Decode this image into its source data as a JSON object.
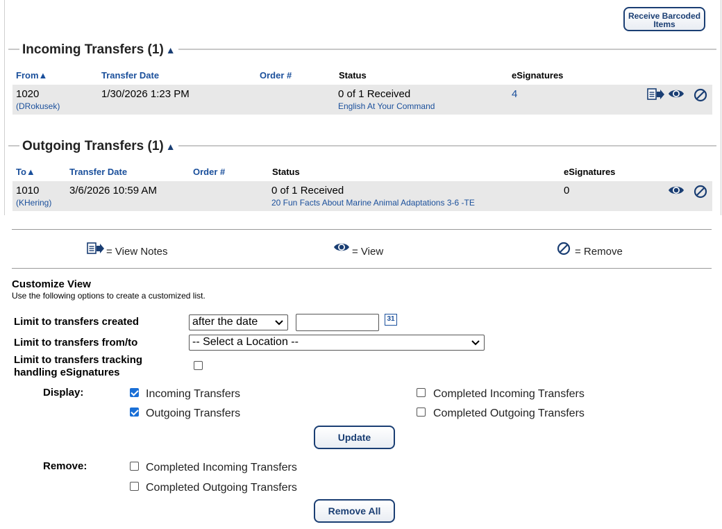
{
  "receive_button": "Receive Barcoded Items",
  "incoming": {
    "title": "Incoming Transfers (1)",
    "sort_arrow": "▲",
    "headers": {
      "from": "From",
      "transfer_date": "Transfer Date",
      "order": "Order #",
      "status": "Status",
      "esignatures": "eSignatures"
    },
    "rows": [
      {
        "location": "1020",
        "user": "(DRokusek)",
        "date": "1/30/2026 1:23 PM",
        "order": "",
        "status": "0 of 1 Received",
        "item": "English At Your Command",
        "esignatures": "4"
      }
    ]
  },
  "outgoing": {
    "title": "Outgoing Transfers (1)",
    "sort_arrow": "▲",
    "headers": {
      "to": "To",
      "transfer_date": "Transfer Date",
      "order": "Order #",
      "status": "Status",
      "esignatures": "eSignatures"
    },
    "rows": [
      {
        "location": "1010",
        "user": "(KHering)",
        "date": "3/6/2026 10:59 AM",
        "order": "",
        "status": "0 of 1 Received",
        "item": "20 Fun Facts About Marine Animal Adaptations 3-6 -TE",
        "esignatures": "0"
      }
    ]
  },
  "legend": {
    "view_notes": "= View Notes",
    "view": "= View",
    "remove": "= Remove"
  },
  "customize": {
    "title": "Customize View",
    "subtitle": "Use the following options to create a customized list.",
    "limit_created_label": "Limit to transfers created",
    "date_mode": "after the date",
    "date_value": "",
    "calendar_day": "31",
    "limit_location_label": "Limit to transfers from/to",
    "location_value": "-- Select a Location --",
    "limit_esig_label_1": "Limit to transfers tracking",
    "limit_esig_label_2": "handling eSignatures",
    "limit_esig_checked": false,
    "display_label": "Display:",
    "display_options": [
      {
        "label": "Incoming Transfers",
        "checked": true
      },
      {
        "label": "Outgoing Transfers",
        "checked": true
      },
      {
        "label": "Completed Incoming Transfers",
        "checked": false
      },
      {
        "label": "Completed Outgoing Transfers",
        "checked": false
      }
    ],
    "update_button": "Update",
    "remove_label": "Remove:",
    "remove_options": [
      {
        "label": "Completed Incoming Transfers",
        "checked": false
      },
      {
        "label": "Completed Outgoing Transfers",
        "checked": false
      }
    ],
    "remove_all_button": "Remove All"
  },
  "colors": {
    "link": "#1a4f9b",
    "row_bg": "#e8e8e8",
    "checkbox_checked": "#1a6fd6",
    "button_border": "#1a3e73"
  }
}
